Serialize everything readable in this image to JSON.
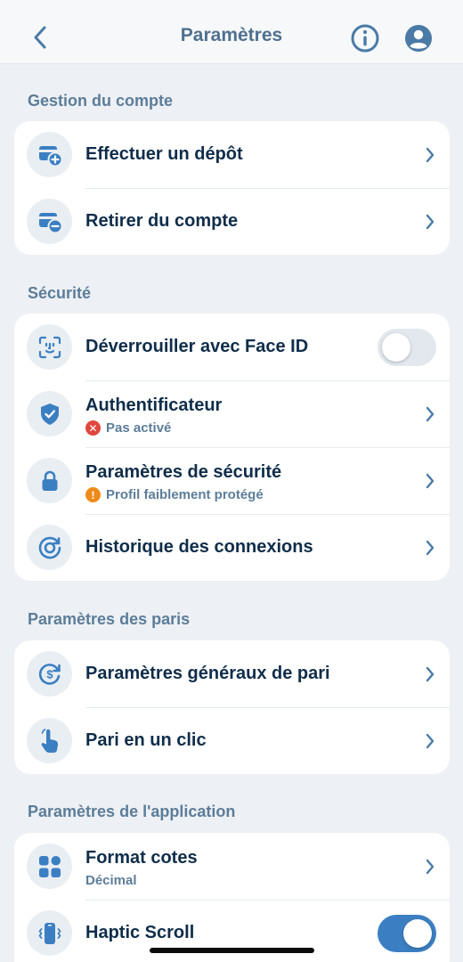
{
  "header": {
    "title": "Paramètres"
  },
  "colors": {
    "accent": "#3b7fc2",
    "icon": "#3b7fc2",
    "error": "#e0463c",
    "warning": "#ee8a1a"
  },
  "sections": {
    "account": {
      "title": "Gestion du compte",
      "items": [
        {
          "label": "Effectuer un dépôt",
          "icon": "wallet-plus-icon"
        },
        {
          "label": "Retirer du compte",
          "icon": "wallet-minus-icon"
        }
      ]
    },
    "security": {
      "title": "Sécurité",
      "items": [
        {
          "label": "Déverrouiller avec Face ID",
          "icon": "face-id-icon",
          "toggle": false
        },
        {
          "label": "Authentificateur",
          "sublabel": "Pas activé",
          "status": "error",
          "icon": "shield-check-icon"
        },
        {
          "label": "Paramètres de sécurité",
          "sublabel": "Profil faiblement protégé",
          "status": "warning",
          "icon": "lock-icon"
        },
        {
          "label": "Historique des connexions",
          "icon": "history-icon"
        }
      ]
    },
    "betting": {
      "title": "Paramètres des paris",
      "items": [
        {
          "label": "Paramètres généraux de pari",
          "icon": "bet-settings-icon"
        },
        {
          "label": "Pari en un clic",
          "icon": "tap-hand-icon"
        }
      ]
    },
    "app": {
      "title": "Paramètres de l'application",
      "items": [
        {
          "label": "Format cotes",
          "sublabel": "Décimal",
          "icon": "grid-icon"
        },
        {
          "label": "Haptic Scroll",
          "icon": "phone-vibrate-icon",
          "toggle": true
        }
      ]
    }
  }
}
